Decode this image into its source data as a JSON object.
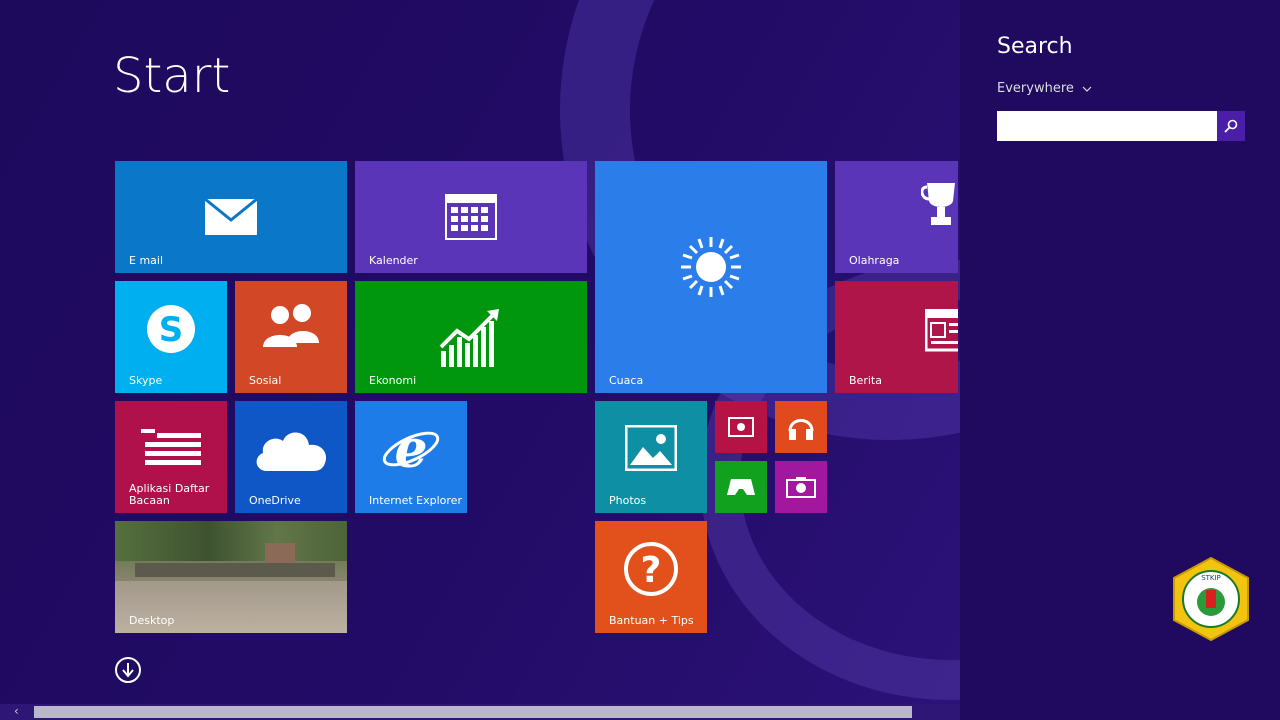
{
  "start": {
    "title": "Start"
  },
  "tiles": {
    "email": "E mail",
    "kalender": "Kalender",
    "cuaca": "Cuaca",
    "olahraga": "Olahraga",
    "skype": "Skype",
    "sosial": "Sosial",
    "ekonomi": "Ekonomi",
    "berita": "Berita",
    "aplikasi": "Aplikasi Daftar Bacaan",
    "onedrive": "OneDrive",
    "ie": "Internet Explorer",
    "photos": "Photos",
    "desktop": "Desktop",
    "bantuan": "Bantuan + Tips"
  },
  "search": {
    "title": "Search",
    "scope": "Everywhere",
    "value": "",
    "placeholder": ""
  },
  "logo": {
    "text": "STKIP"
  },
  "colors": {
    "background": "#1e0a5e",
    "accent": "#4b1ea8"
  }
}
